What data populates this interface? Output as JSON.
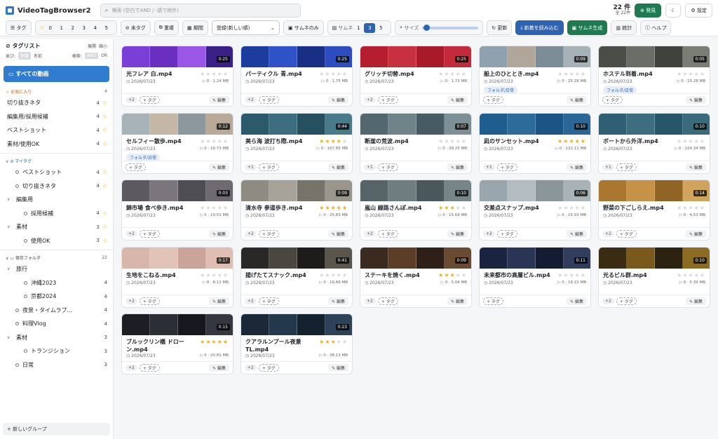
{
  "header": {
    "title": "VideoTagBrowser2",
    "search_placeholder": "検索 (空白でAND / -語で除外)",
    "count_value": "22 件",
    "count_total": "全 22件",
    "discover_label": "発見",
    "theme_icon": "moon-icon",
    "settings_label": "設定"
  },
  "toolbar": {
    "tag_label": "タグ",
    "ratings": [
      "0",
      "1",
      "2",
      "3",
      "4",
      "5"
    ],
    "untagged_label": "未タグ",
    "dup_label": "重複",
    "period_label": "期間",
    "sort_value": "登録(新しい順)",
    "thumb_only_label": "サムネのみ",
    "thumb_label": "サムネ",
    "thumb_nums": [
      "1",
      "3",
      "5"
    ],
    "thumb_selected": "3",
    "size_label": "サイズ",
    "refresh_label": "更新",
    "load_new_label": "新着を読み込む",
    "gen_thumb_label": "サムネ生成",
    "stats_label": "統計",
    "help_label": "ヘルプ"
  },
  "sidebar": {
    "title": "タグリスト",
    "expand_label": "展開",
    "collapse_label": "縮小",
    "sort_label": "並び:",
    "sort_opts": [
      "件数",
      "名前"
    ],
    "mode_label": "検索:",
    "mode_opts": [
      "AND",
      "OR"
    ],
    "all_label": "すべての動画",
    "fav_title": "お気に入り",
    "fav_count": "4",
    "favs": [
      {
        "label": "切り抜きネタ",
        "count": "4"
      },
      {
        "label": "編集用/採用候補",
        "count": "4"
      },
      {
        "label": "ベストショット",
        "count": "4"
      },
      {
        "label": "素材/使用OK",
        "count": "4"
      }
    ],
    "mytag_title": "マイタグ",
    "mytags": [
      {
        "label": "ベストショット",
        "count": "4",
        "indent": 1,
        "arrow": ""
      },
      {
        "label": "切り抜きネタ",
        "count": "4",
        "indent": 1,
        "arrow": ""
      },
      {
        "label": "編集用",
        "count": "",
        "indent": 0,
        "arrow": "∨"
      },
      {
        "label": "採用候補",
        "count": "4",
        "indent": 2,
        "arrow": ""
      },
      {
        "label": "素材",
        "count": "3",
        "indent": 0,
        "arrow": "∨"
      },
      {
        "label": "使用OK",
        "count": "3",
        "indent": 2,
        "arrow": ""
      }
    ],
    "folder_title": "保存フォルダ",
    "folder_count": "22",
    "folders": [
      {
        "label": "旅行",
        "count": "",
        "indent": 0,
        "arrow": "∨"
      },
      {
        "label": "沖縄2023",
        "count": "4",
        "indent": 2,
        "arrow": ""
      },
      {
        "label": "京都2024",
        "count": "4",
        "indent": 2,
        "arrow": ""
      },
      {
        "label": "夜景・タイムラプ...",
        "count": "4",
        "indent": 1,
        "arrow": ""
      },
      {
        "label": "料理Vlog",
        "count": "4",
        "indent": 1,
        "arrow": ""
      },
      {
        "label": "素材",
        "count": "3",
        "indent": 0,
        "arrow": "∨"
      },
      {
        "label": "トランジション",
        "count": "3",
        "indent": 2,
        "arrow": ""
      },
      {
        "label": "日常",
        "count": "3",
        "indent": 1,
        "arrow": ""
      }
    ],
    "new_group_label": "+ 新しいグループ"
  },
  "videos": [
    {
      "name": "光フレア 白.mp4",
      "dur": "0:25",
      "stars": 0,
      "date": "2026/07/23",
      "meta": "0 · 1.24 MB",
      "folder": "",
      "chip": "+2",
      "colors": [
        "#7a3fd6",
        "#6b2fc0",
        "#9a56e6",
        "#3a1f86"
      ]
    },
    {
      "name": "パーティクル 青.mp4",
      "dur": "0:25",
      "stars": 0,
      "date": "2026/07/23",
      "meta": "0 · 1.75 MB",
      "folder": "",
      "chip": "+2",
      "colors": [
        "#1c3c9e",
        "#3052c8",
        "#182f86",
        "#2d4cc0"
      ]
    },
    {
      "name": "グリッチ切替.mp4",
      "dur": "0:25",
      "stars": 0,
      "date": "2026/07/23",
      "meta": "0 · 1.73 MB",
      "folder": "",
      "chip": "+2",
      "colors": [
        "#b51e2e",
        "#c7303d",
        "#a81a28",
        "#c42b3a"
      ]
    },
    {
      "name": "船上のひととき.mp4",
      "dur": "0:09",
      "stars": 0,
      "date": "2026/07/23",
      "meta": "0 · 25.28 MB",
      "folder": "フォルダ/日常",
      "chip": "",
      "colors": [
        "#8fa1ae",
        "#b0a699",
        "#7c8d98",
        "#a7b1b8"
      ]
    },
    {
      "name": "ホステル到着.mp4",
      "dur": "0:05",
      "stars": 0,
      "date": "2026/07/23",
      "meta": "0 · 15.28 MB",
      "folder": "フォルダ/日常",
      "chip": "",
      "colors": [
        "#4a4d48",
        "#6a6e66",
        "#3f423d",
        "#7a7d74"
      ]
    },
    {
      "name": "セルフィー散歩.mp4",
      "dur": "0:12",
      "stars": 0,
      "date": "2026/07/23",
      "meta": "0 · 16.73 MB",
      "folder": "フォルダ/日常",
      "chip": "",
      "colors": [
        "#a8b2b9",
        "#c5b7a6",
        "#8d979e",
        "#b8a998"
      ]
    },
    {
      "name": "美ら海 波打ち際.mp4",
      "dur": "0:44",
      "stars": 4,
      "date": "2026/07/23",
      "meta": "0 · 167.85 MB",
      "folder": "",
      "chip": "+1",
      "colors": [
        "#2d5a6b",
        "#3c6e80",
        "#26505f",
        "#487a8a"
      ]
    },
    {
      "name": "断崖の荒波.mp4",
      "dur": "0:07",
      "stars": 0,
      "date": "2026/07/23",
      "meta": "0 · 38.25 MB",
      "folder": "",
      "chip": "+1",
      "colors": [
        "#52686e",
        "#6f8489",
        "#465c62",
        "#7c9095"
      ]
    },
    {
      "name": "凪のサンセット.mp4",
      "dur": "0:10",
      "stars": 5,
      "date": "2026/07/23",
      "meta": "0 · 122.11 MB",
      "folder": "",
      "chip": "+1",
      "colors": [
        "#1e5d8e",
        "#2c6b9a",
        "#1a5585",
        "#2a6797"
      ]
    },
    {
      "name": "ボートから外洋.mp4",
      "dur": "0:10",
      "stars": 0,
      "date": "2026/07/23",
      "meta": "0 · 224.34 MB",
      "folder": "",
      "chip": "+1",
      "colors": [
        "#2f5f73",
        "#3d6e80",
        "#285669",
        "#3a6b7d"
      ]
    },
    {
      "name": "錦市場 食べ歩き.mp4",
      "dur": "0:03",
      "stars": 0,
      "date": "2026/07/23",
      "meta": "0 · 10.51 MB",
      "folder": "",
      "chip": "+2",
      "colors": [
        "#5c5a60",
        "#7a767c",
        "#4f4d54",
        "#6e6a70"
      ]
    },
    {
      "name": "清水寺 参道歩き.mp4",
      "dur": "0:09",
      "stars": 5,
      "date": "2026/07/23",
      "meta": "0 · 25.83 MB",
      "folder": "",
      "chip": "+2",
      "colors": [
        "#8e8b82",
        "#a7a39a",
        "#76736b",
        "#9a968d"
      ]
    },
    {
      "name": "嵐山 線路さんぽ.mp4",
      "dur": "0:10",
      "stars": 3,
      "date": "2026/07/23",
      "meta": "0 · 15.69 MB",
      "folder": "",
      "chip": "+2",
      "colors": [
        "#56646a",
        "#6d7d80",
        "#4a585d",
        "#768587"
      ]
    },
    {
      "name": "交差点スナップ.mp4",
      "dur": "0:06",
      "stars": 0,
      "date": "2026/07/23",
      "meta": "0 · 15.93 MB",
      "folder": "",
      "chip": "+2",
      "colors": [
        "#9aa6ad",
        "#b3bcc1",
        "#8a959c",
        "#a9b2b7"
      ]
    },
    {
      "name": "野菜の下ごしらえ.mp4",
      "dur": "0:14",
      "stars": 0,
      "date": "2026/07/23",
      "meta": "0 · 4.53 MB",
      "folder": "",
      "chip": "+2",
      "colors": [
        "#a9772f",
        "#c69248",
        "#8f6425",
        "#d0a45c"
      ]
    },
    {
      "name": "生地をこねる.mp4",
      "dur": "0:17",
      "stars": 0,
      "date": "2026/07/23",
      "meta": "0 · 8.12 MB",
      "folder": "",
      "chip": "+2",
      "colors": [
        "#d8b6ab",
        "#e2c3b8",
        "#caa498",
        "#dfbeb3"
      ]
    },
    {
      "name": "揚げたてスナック.mp4",
      "dur": "0:41",
      "stars": 0,
      "date": "2026/07/23",
      "meta": "0 · 16.66 MB",
      "folder": "",
      "chip": "+2",
      "colors": [
        "#2a2826",
        "#4a4640",
        "#1e1c1a",
        "#5a554d"
      ]
    },
    {
      "name": "ステーキを焼く.mp4",
      "dur": "0:09",
      "stars": 3,
      "date": "2026/07/23",
      "meta": "0 · 5.04 MB",
      "folder": "",
      "chip": "+2",
      "colors": [
        "#3a2a20",
        "#5c3e28",
        "#2e2018",
        "#6a4a30"
      ]
    },
    {
      "name": "未来都市の高層ビル.mp4",
      "dur": "0:11",
      "stars": 0,
      "date": "2026/07/23",
      "meta": "0 · 16.22 MB",
      "folder": "",
      "chip": "",
      "colors": [
        "#1a2440",
        "#2a3454",
        "#141c34",
        "#323c5c"
      ]
    },
    {
      "name": "光るビル群.mp4",
      "dur": "0:10",
      "stars": 0,
      "date": "2026/07/23",
      "meta": "0 · 5.39 MB",
      "folder": "",
      "chip": "+2",
      "colors": [
        "#3a2c12",
        "#7a5a1c",
        "#2c2210",
        "#8c6c24"
      ]
    },
    {
      "name": "ブルックリン橋 ドローン.mp4",
      "dur": "0:15",
      "stars": 5,
      "date": "2026/07/23",
      "meta": "0 · 20.81 MB",
      "folder": "",
      "chip": "+2",
      "colors": [
        "#1c1e24",
        "#2c2e36",
        "#16181e",
        "#343640"
      ]
    },
    {
      "name": "クアラルンプール夜景TL.mp4",
      "dur": "0:23",
      "stars": 3,
      "date": "2026/07/23",
      "meta": "0 · 38.13 MB",
      "folder": "",
      "chip": "+2",
      "colors": [
        "#1a2838",
        "#24384c",
        "#142230",
        "#2c4258"
      ]
    }
  ],
  "card_labels": {
    "add_tag": "+ タグ",
    "edit": "編集"
  },
  "colors": {
    "accent": "#2f63b0",
    "green": "#1f7a52",
    "star": "#e7b021"
  }
}
